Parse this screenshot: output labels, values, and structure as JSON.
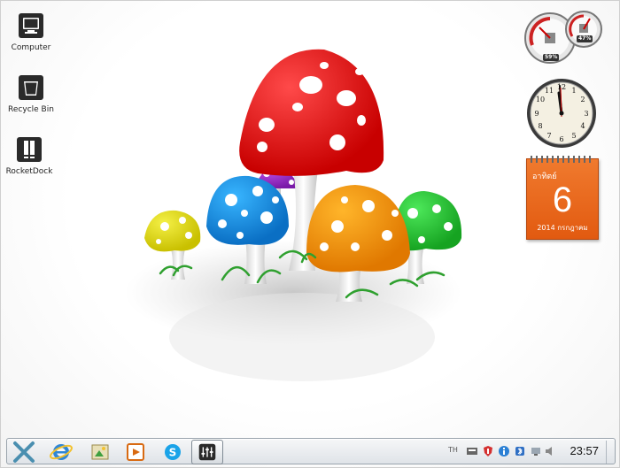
{
  "desktop_icons": [
    {
      "label": "Computer",
      "icon": "computer-icon"
    },
    {
      "label": "Recycle Bin",
      "icon": "recycle-bin-icon"
    },
    {
      "label": "RocketDock",
      "icon": "rocketdock-icon"
    }
  ],
  "gadgets": {
    "cpu_meter": {
      "cpu": "59%",
      "memory": "47%"
    },
    "clock": {
      "hour": 11,
      "minute": 57
    },
    "calendar": {
      "day_of_week": "อาทิตย์",
      "day": "6",
      "month_year": "2014 กรกฎาคม"
    }
  },
  "taskbar": {
    "start_icon": "x-start-icon",
    "pinned": [
      "internet-explorer-icon",
      "file-explorer-icon",
      "media-player-icon",
      "skype-icon",
      "mixer-icon"
    ],
    "tray_language": "TH",
    "tray_icons": [
      "keyboard-icon",
      "security-shield-icon",
      "info-icon",
      "bluetooth-icon",
      "network-icon",
      "volume-icon"
    ],
    "clock": "23:57"
  }
}
